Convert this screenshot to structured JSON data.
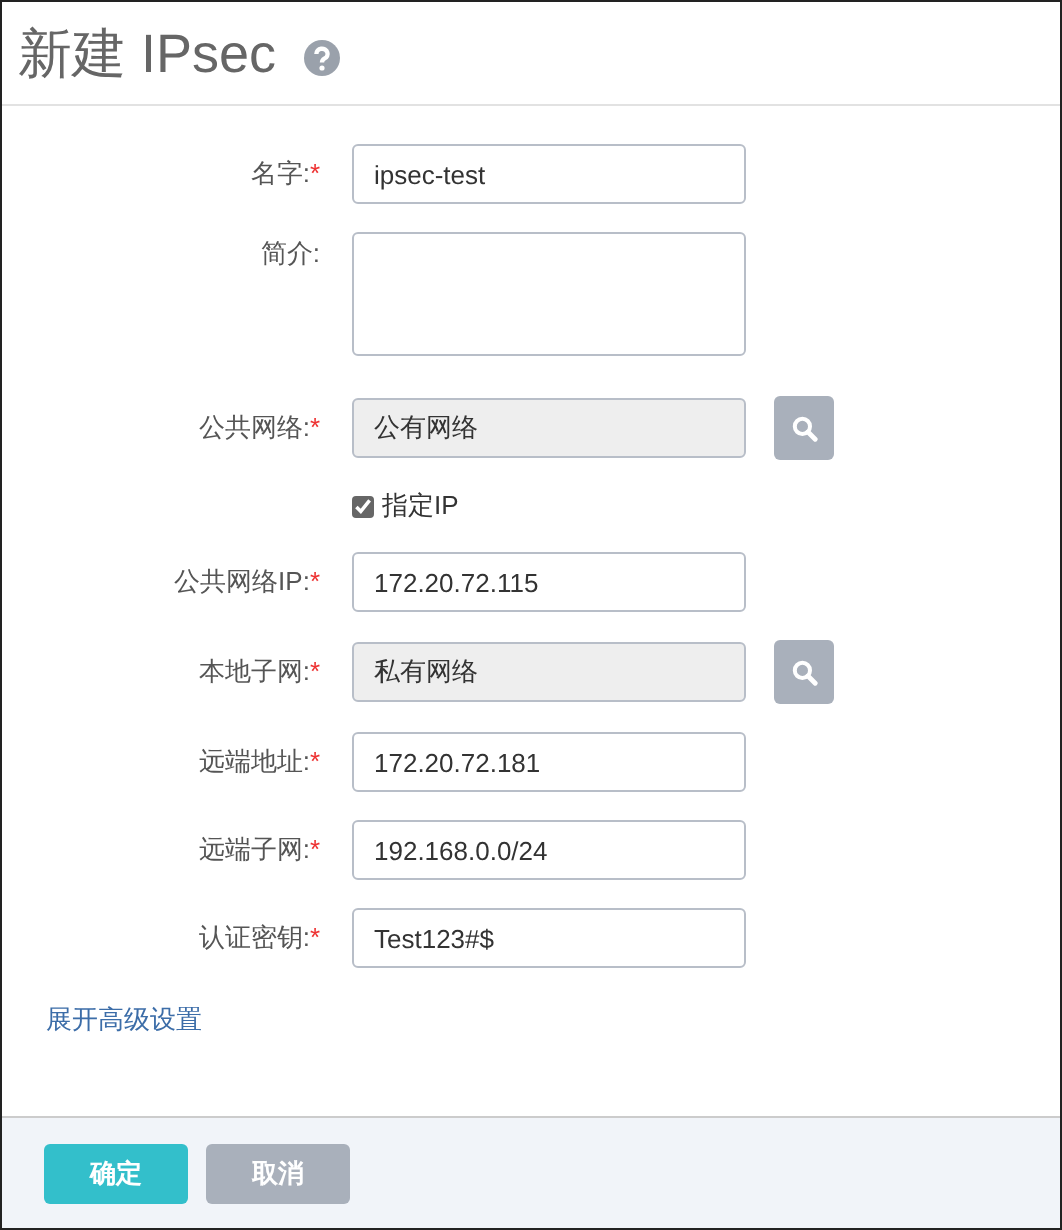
{
  "title": "新建 IPsec",
  "fields": [
    {
      "kind": "text",
      "label": "名字:",
      "required_mark": "*",
      "value": "ipsec-test"
    },
    {
      "kind": "textarea",
      "label": "简介:"
    },
    {
      "kind": "picker",
      "label": "公共网络:",
      "required_mark": "*",
      "value": "公有网络"
    },
    {
      "kind": "checkbox",
      "label": "指定IP",
      "checked": true
    },
    {
      "kind": "text",
      "label": "公共网络IP:",
      "required_mark": "*",
      "value": "172.20.72.115"
    },
    {
      "kind": "picker",
      "label": "本地子网:",
      "required_mark": "*",
      "value": "私有网络"
    },
    {
      "kind": "text",
      "label": "远端地址:",
      "required_mark": "*",
      "value": "172.20.72.181"
    },
    {
      "kind": "text",
      "label": "远端子网:",
      "required_mark": "*",
      "value": "192.168.0.0/24"
    },
    {
      "kind": "text",
      "label": "认证密钥:",
      "required_mark": "*",
      "value": "Test123#$"
    }
  ],
  "advanced_link": "展开高级设置",
  "buttons": [
    {
      "kind": "primary",
      "label": "确定"
    },
    {
      "kind": "secondary",
      "label": "取消"
    }
  ]
}
